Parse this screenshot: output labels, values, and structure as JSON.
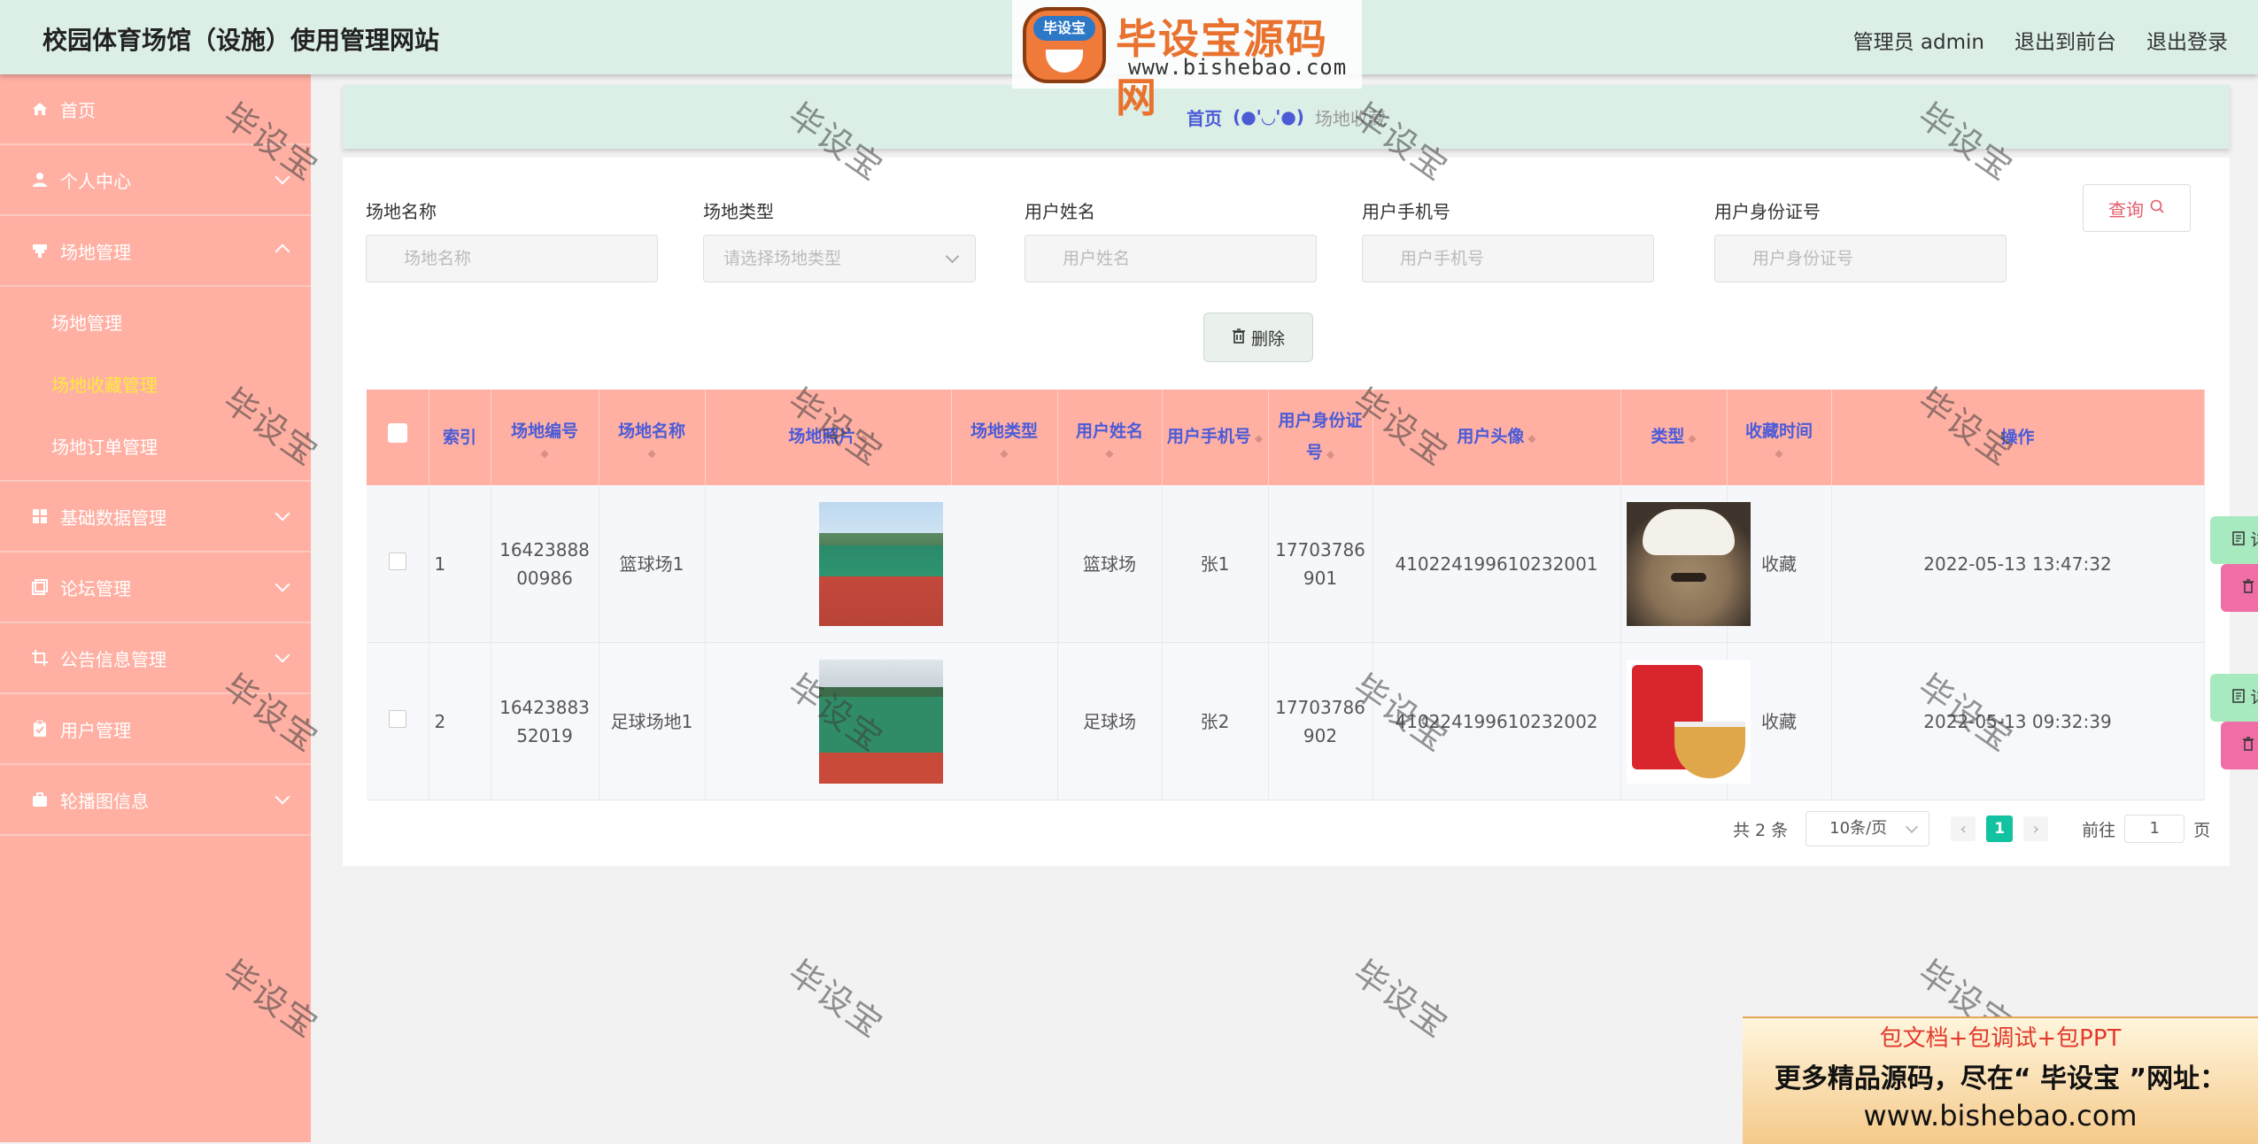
{
  "header": {
    "site_title": "校园体育场馆（设施）使用管理网站",
    "user_label": "管理员 admin",
    "to_front": "退出到前台",
    "logout": "退出登录"
  },
  "logo": {
    "badge": "毕设宝",
    "title": "毕设宝源码网",
    "url": "www.bishebao.com"
  },
  "sidebar": {
    "items": [
      {
        "label": "首页",
        "icon": "home-icon"
      },
      {
        "label": "个人中心",
        "icon": "user-icon"
      },
      {
        "label": "场地管理",
        "icon": "venue-icon",
        "expanded": true,
        "children": [
          "场地管理",
          "场地收藏管理",
          "场地订单管理"
        ],
        "active_child": "场地收藏管理"
      },
      {
        "label": "基础数据管理",
        "icon": "grid-icon"
      },
      {
        "label": "论坛管理",
        "icon": "forum-icon"
      },
      {
        "label": "公告信息管理",
        "icon": "crop-icon"
      },
      {
        "label": "用户管理",
        "icon": "clipboard-icon"
      },
      {
        "label": "轮播图信息",
        "icon": "briefcase-icon"
      }
    ]
  },
  "breadcrumb": {
    "home": "首页",
    "separator": "(●'◡'●)",
    "current": "场地收藏"
  },
  "search": {
    "fields": [
      {
        "label": "场地名称",
        "placeholder": "场地名称"
      },
      {
        "label": "场地类型",
        "placeholder": "请选择场地类型"
      },
      {
        "label": "用户姓名",
        "placeholder": "用户姓名"
      },
      {
        "label": "用户手机号",
        "placeholder": "用户手机号"
      },
      {
        "label": "用户身份证号",
        "placeholder": "用户身份证号"
      }
    ],
    "query_label": "查询",
    "batch_delete_label": "删除"
  },
  "table": {
    "columns": [
      "索引",
      "场地编号",
      "场地名称",
      "场地照片",
      "场地类型",
      "用户姓名",
      "用户手机号",
      "用户身份证号",
      "用户头像",
      "类型",
      "收藏时间",
      "操作"
    ],
    "rows": [
      {
        "index": "1",
        "venue_no": "1642388800986",
        "venue_name": "篮球场1",
        "photo": "basketball-court-photo",
        "venue_type": "篮球场",
        "user_name": "张1",
        "phone": "17703786901",
        "id_card": "410224199610232001",
        "avatar": "cat-avatar",
        "type": "收藏",
        "time": "2022-05-13 13:47:32"
      },
      {
        "index": "2",
        "venue_no": "1642388352019",
        "venue_name": "足球场地1",
        "photo": "football-court-photo",
        "venue_type": "足球场",
        "user_name": "张2",
        "phone": "17703786902",
        "id_card": "410224199610232002",
        "avatar": "snack-avatar",
        "type": "收藏",
        "time": "2022-05-13 09:32:39"
      }
    ],
    "detail_label": "详情",
    "delete_label": "删除"
  },
  "pagination": {
    "total": "共 2 条",
    "page_size": "10条/页",
    "current_page": "1",
    "goto_prefix": "前往",
    "goto_value": "1",
    "goto_suffix": "页"
  },
  "watermark": "毕设宝",
  "promo": {
    "line1": "包文档+包调试+包PPT",
    "line2": "更多精品源码，尽在“ 毕设宝 ”网址：",
    "line3": "www.bishebao.com"
  },
  "colors": {
    "sidebar_bg": "#ffb0a3",
    "header_bg": "#dbefe6",
    "active_submenu": "#ffeb3b",
    "accent_blue": "#4b5bd8",
    "detail_btn": "#a7eac0",
    "delete_btn": "#ef6ea6",
    "page_active": "#13c2a0"
  }
}
